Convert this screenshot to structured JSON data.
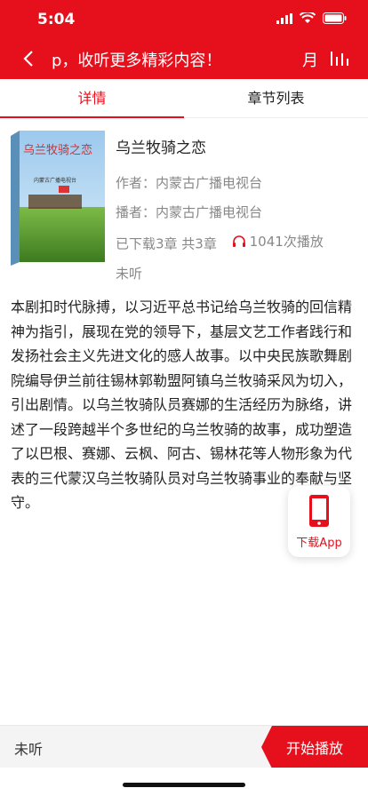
{
  "status_bar": {
    "time": "5:04"
  },
  "nav": {
    "marquee_text": "p，收听更多精彩内容！",
    "right_glyph": "月"
  },
  "tabs": [
    {
      "label": "详情",
      "active": true
    },
    {
      "label": "章节列表",
      "active": false
    }
  ],
  "book": {
    "cover_title": "乌兰牧骑之恋",
    "cover_subtitle": "内蒙古广播电视台",
    "title": "乌兰牧骑之恋",
    "author_label": "作者：",
    "author": "内蒙古广播电视台",
    "narrator_label": "播者：",
    "narrator": "内蒙古广播电视台",
    "downloaded": "已下载3章 共3章",
    "plays": "1041次播放",
    "listen_state": "未听"
  },
  "description": "本剧扣时代脉搏，以习近平总书记给乌兰牧骑的回信精神为指引，展现在党的领导下，基层文艺工作者践行和发扬社会主义先进文化的感人故事。以中央民族歌舞剧院编导伊兰前往锡林郭勒盟阿镇乌兰牧骑采风为切入，引出剧情。以乌兰牧骑队员赛娜的生活经历为脉络，讲述了一段跨越半个多世纪的乌兰牧骑的故事，成功塑造了以巴根、赛娜、云枫、阿古、锡林花等人物形象为代表的三代蒙汉乌兰牧骑队员对乌兰牧骑事业的奉献与坚守。",
  "float_download": {
    "label": "下载App"
  },
  "bottom_bar": {
    "state": "未听",
    "play_label": "开始播放"
  },
  "colors": {
    "brand_red": "#e6101d"
  }
}
